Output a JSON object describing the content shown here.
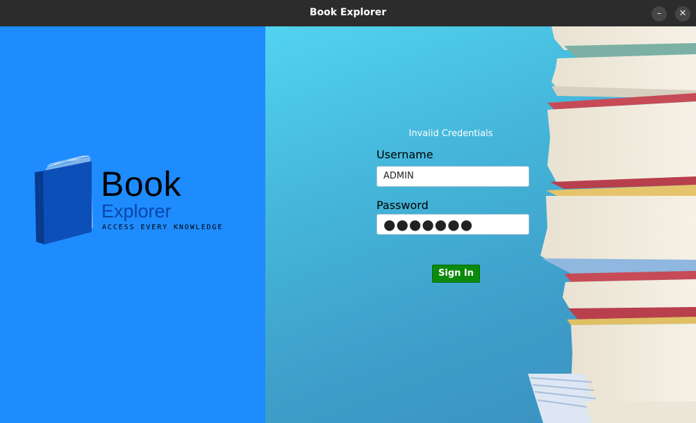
{
  "window": {
    "title": "Book Explorer",
    "minimize_icon": "minimize-icon",
    "close_icon": "close-icon"
  },
  "brand": {
    "name": "Book",
    "subname": "Explorer",
    "tagline": "ACCESS EVERY KNOWLEDGE",
    "logo_icon": "book-icon"
  },
  "login": {
    "error_message": "Invalid Credentials",
    "username_label": "Username",
    "username_value": "ADMIN",
    "password_label": "Password",
    "password_value": "●●●●●●●",
    "signin_label": "Sign In"
  },
  "colors": {
    "left_panel": "#1e8cff",
    "signin_button": "#0c8a0c",
    "brand_subname": "#0a44a8"
  }
}
